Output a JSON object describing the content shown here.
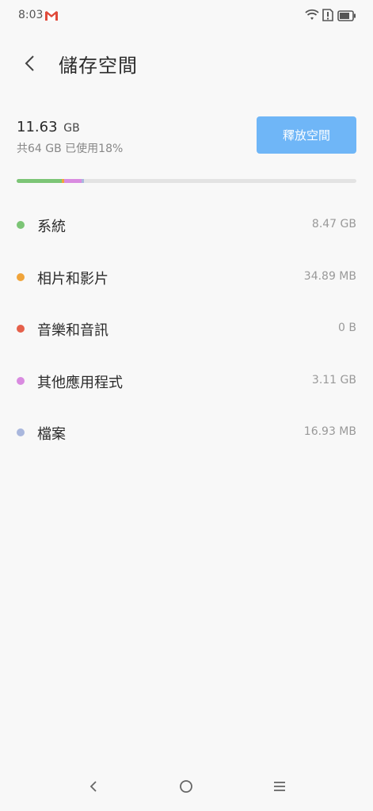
{
  "status_bar": {
    "time": "8:03",
    "icons": [
      "gmail-icon",
      "wifi-icon",
      "alert-icon",
      "battery-icon"
    ]
  },
  "header": {
    "title": "儲存空間",
    "back_icon": "chevron-left-icon"
  },
  "summary": {
    "used_value": "11.63",
    "used_unit": "GB",
    "description": "共64 GB 已使用18%",
    "free_button_label": "釋放空間",
    "free_button_color": "#6fb6f7",
    "used_percent": 18
  },
  "usage_bar": {
    "track_color": "#e3e3e3",
    "segments": [
      {
        "name": "系統",
        "color": "#7cc576",
        "fraction": 0.132
      },
      {
        "name": "相片和影片",
        "color": "#f0a43a",
        "fraction": 0.009
      },
      {
        "name": "其他應用程式",
        "color": "#d98be0",
        "fraction": 0.049
      },
      {
        "name": "檔案",
        "color": "#a9b7dd",
        "fraction": 0.009
      }
    ]
  },
  "storage_items": [
    {
      "label": "系統",
      "size": "8.47 GB",
      "color": "#7cc576"
    },
    {
      "label": "相片和影片",
      "size": "34.89 MB",
      "color": "#f0a43a"
    },
    {
      "label": "音樂和音訊",
      "size": "0 B",
      "color": "#e5604a"
    },
    {
      "label": "其他應用程式",
      "size": "3.11 GB",
      "color": "#d98be0"
    },
    {
      "label": "檔案",
      "size": "16.93 MB",
      "color": "#a9b7dd"
    }
  ],
  "nav_bar": {
    "icons": [
      "back-nav-icon",
      "home-nav-icon",
      "menu-nav-icon"
    ]
  }
}
